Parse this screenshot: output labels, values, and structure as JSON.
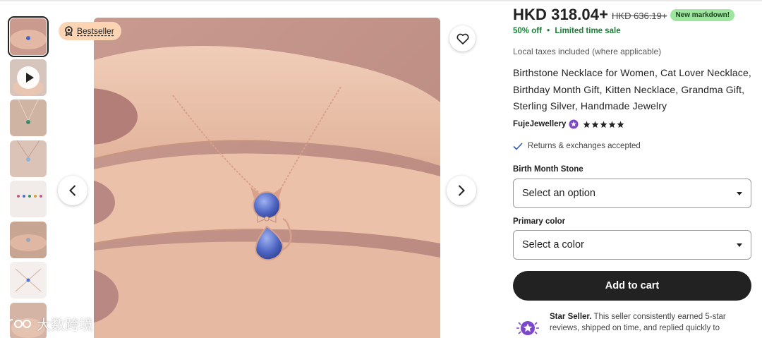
{
  "gallery": {
    "thumbnails": [
      {
        "name": "thumb-1",
        "active": true
      },
      {
        "name": "thumb-2-video"
      },
      {
        "name": "thumb-3"
      },
      {
        "name": "thumb-4"
      },
      {
        "name": "thumb-5"
      },
      {
        "name": "thumb-6"
      },
      {
        "name": "thumb-7"
      },
      {
        "name": "thumb-8"
      }
    ],
    "bestseller_label": "Bestseller",
    "watermark_text": "大数跨境"
  },
  "product": {
    "price": "HKD 318.04+",
    "original_price": "HKD 636.19+",
    "markdown_badge": "New markdown!",
    "discount": "50% off",
    "sale_separator": "•",
    "sale_note": "Limited time sale",
    "tax_note": "Local taxes included (where applicable)",
    "title": "Birthstone Necklace for Women, Cat Lover Necklace, Birthday Month Gift, Kitten Necklace, Grandma Gift, Sterling Silver, Handmade Jewelry",
    "shop_name": "FujeJewellery",
    "rating_stars": 5,
    "returns": "Returns & exchanges accepted"
  },
  "options": {
    "birth_stone_label": "Birth Month Stone",
    "birth_stone_value": "Select an option",
    "color_label": "Primary color",
    "color_value": "Select a color"
  },
  "actions": {
    "add_to_cart": "Add to cart"
  },
  "star_seller": {
    "title": "Star Seller.",
    "text": "This seller consistently earned 5-star reviews, shipped on time, and replied quickly to"
  },
  "colors": {
    "accent_dark": "#222222",
    "sale_green": "#1a7f37",
    "badge_green": "#9ee5a0",
    "bestseller_bg": "#fbd4b4",
    "star_seller_purple": "#7d47c9"
  }
}
